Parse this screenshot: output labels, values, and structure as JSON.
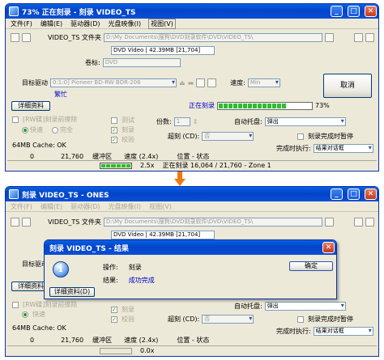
{
  "window1": {
    "title": "73% 正在刻录 - 刻录 VIDEO_TS",
    "menu": [
      "文件(F)",
      "编辑(E)",
      "驱动器(D)",
      "光盘映像(I)",
      "视图(V)"
    ],
    "folder_label": "VIDEO_TS 文件夹",
    "folder_path": "D:\\My Documents\\搜狗\\DVD刻录软件\\DVD\\VIDEO_TS\\",
    "format_info": "DVD Video | 42.39MB [21,704]",
    "volume_label": "卷标:",
    "volume_value": "DVD",
    "target_drive_label": "目标驱动",
    "target_drive_value": "0:1:0] Pioneer BD-RW BDR-206",
    "status_busy": "繁忙",
    "speed_label": "速度:",
    "speed_value": "Min",
    "cancel_button": "取消",
    "details_button": "详细资料",
    "burning_label": "正在刻录",
    "progress_percent": 73,
    "progress_text": "73%",
    "recover_checkbox": "[RW碟]刻录前擦除",
    "radio_fast": "快速",
    "radio_full": "完全",
    "check_test": "测试",
    "check_burn": "刻录",
    "check_verify": "校验",
    "copies_label": "份数:",
    "copies_value": "1",
    "auto_tray_label": "自动托盘:",
    "auto_tray_value": "弹出",
    "overburn_label": "超刻 (CD):",
    "overburn_value": "否",
    "notify_checkbox": "刻录完成时暂停",
    "on_complete_label": "完成时执行:",
    "on_complete_value": "结果对话框",
    "cache_label": "64MB Cache: OK",
    "buffer_label": "缓冲区",
    "speed_status": "速度 (2.4x)",
    "position_status": "位置 - 状态",
    "status_count": "21,760",
    "status_zero": "0",
    "status_speed": "2.5x",
    "status_position": "正在刻录 16,064 / 21,760 - Zone 1"
  },
  "window2": {
    "title": "刻录 VIDEO_TS - ONES",
    "menu": [
      "文件(F)",
      "编辑(E)",
      "驱动器(D)",
      "光盘映像(I)",
      "视图(V)"
    ],
    "folder_label": "VIDEO_TS 文件夹",
    "folder_path": "D:\\My Documents\\搜狗\\DVD刻录软件\\DVD\\VIDEO_TS\\",
    "format_info": "DVD Video | 42.39MB [21,704]",
    "target_drive_label": "目标驱动",
    "details_button": "详细资料",
    "recover_checkbox": "[RW碟]刻录前擦除",
    "radio_fast": "快速",
    "check_burn": "刻录",
    "check_verify": "校验",
    "auto_tray_label": "自动托盘:",
    "auto_tray_value": "弹出",
    "overburn_label": "超刻 (CD):",
    "overburn_value": "否",
    "notify_checkbox": "刻录完成时暂停",
    "on_complete_label": "完成时执行:",
    "on_complete_value": "结果对话框",
    "cache_label": "64MB Cache: OK",
    "buffer_label": "缓冲区",
    "speed_status": "速度 (2.4x)",
    "position_status": "位置 - 状态",
    "status_count": "21,760",
    "status_zero": "0",
    "status_speed": "0.0x"
  },
  "dialog": {
    "title": "刻录 VIDEO_TS - 结果",
    "operation_label": "操作:",
    "operation_value": "刻录",
    "result_label": "结果:",
    "result_value": "成功完成",
    "ok_button": "确定",
    "details_button": "详细资料(D)"
  },
  "colors": {
    "titlebar": "#0a5fe4",
    "progress": "#2ebd2e",
    "busy_text": "#0000c8",
    "success_text": "#0000c8",
    "arrow": "#f07a10"
  }
}
